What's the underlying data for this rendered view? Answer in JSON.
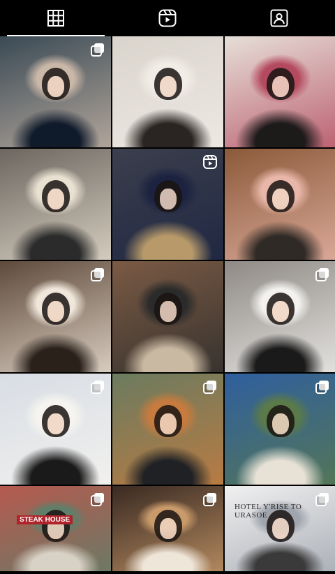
{
  "tabs": [
    {
      "name": "posts",
      "icon": "grid-icon",
      "active": true
    },
    {
      "name": "reels",
      "icon": "reels-icon",
      "active": false
    },
    {
      "name": "tagged",
      "icon": "tagged-person-icon",
      "active": false
    }
  ],
  "grid": {
    "posts": [
      {
        "badge": "carousel-icon",
        "colors": [
          "#3a4a55",
          "#c9b7a8",
          "#0f1a2b"
        ]
      },
      {
        "badge": "none",
        "colors": [
          "#d9d4cc",
          "#f1ece6",
          "#2a2522"
        ]
      },
      {
        "badge": "none",
        "colors": [
          "#e6dfd8",
          "#b44a5f",
          "#1d1a1a"
        ]
      },
      {
        "badge": "none",
        "colors": [
          "#6d6660",
          "#e8e0d0",
          "#2b2b2b"
        ]
      },
      {
        "badge": "reel-icon",
        "colors": [
          "#3b3f4d",
          "#1b2340",
          "#b89a6a"
        ]
      },
      {
        "badge": "none",
        "colors": [
          "#8b5a3a",
          "#e9b7a9",
          "#2f2a26"
        ]
      },
      {
        "badge": "carousel-icon",
        "colors": [
          "#5e4a3b",
          "#f0e6da",
          "#2a211b"
        ]
      },
      {
        "badge": "none",
        "colors": [
          "#7a5a44",
          "#2b2b2b",
          "#c9b9a2"
        ]
      },
      {
        "badge": "carousel-icon",
        "colors": [
          "#8f8a86",
          "#f3f2ef",
          "#1a1a1a"
        ]
      },
      {
        "badge": "carousel-icon",
        "colors": [
          "#d8dde4",
          "#f6f4f0",
          "#1a1a1a"
        ]
      },
      {
        "badge": "carousel-icon",
        "colors": [
          "#6b7b5f",
          "#c77b3e",
          "#1f2125"
        ]
      },
      {
        "badge": "carousel-icon",
        "colors": [
          "#2f5f9e",
          "#5a7a4a",
          "#e8e2d6"
        ]
      },
      {
        "badge": "carousel-icon",
        "colors": [
          "#b55a4e",
          "#5f7f6a",
          "#d8d2c6"
        ]
      },
      {
        "badge": "carousel-icon",
        "colors": [
          "#3a2a22",
          "#c99a6a",
          "#efe6da"
        ]
      },
      {
        "badge": "carousel-icon",
        "colors": [
          "#f0f0f0",
          "#9fa4ad",
          "#3a3a3a"
        ]
      }
    ]
  },
  "signs": {
    "steak_house": "STEAK HOUSE",
    "hotel": "HOTEL Y'RISE TO URASOE"
  },
  "accent": "#ffffff"
}
